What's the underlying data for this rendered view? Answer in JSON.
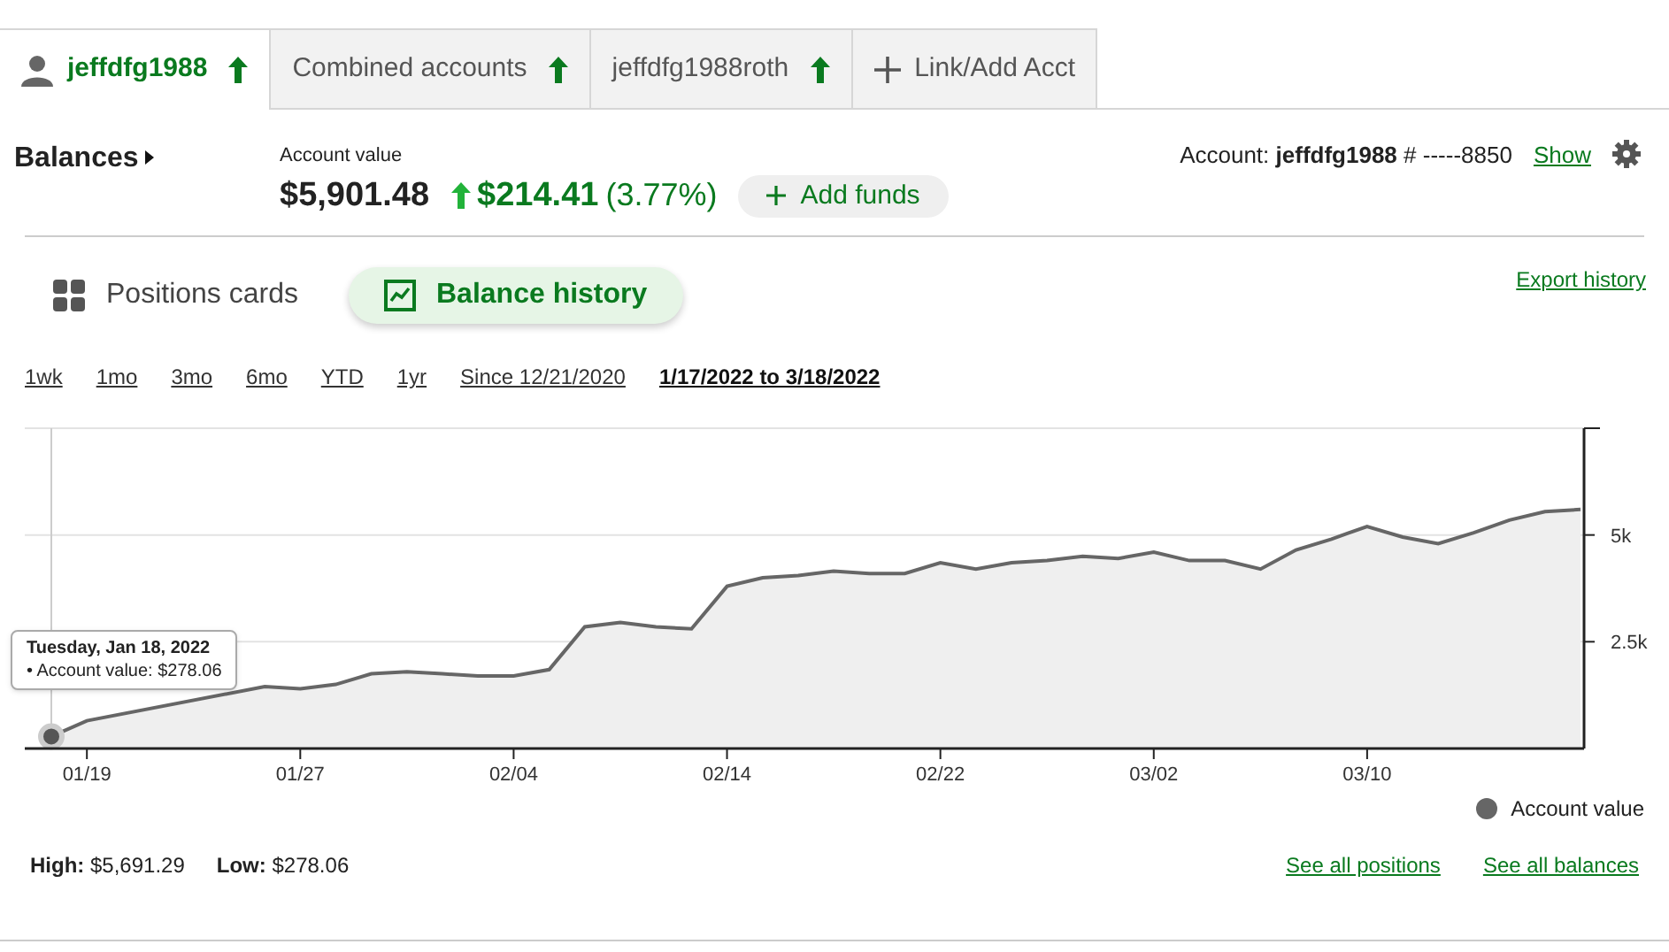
{
  "tabs": [
    {
      "label": "jeffdfg1988",
      "kind": "user",
      "selected": true
    },
    {
      "label": "Combined accounts",
      "kind": "account",
      "selected": false
    },
    {
      "label": "jeffdfg1988roth",
      "kind": "account",
      "selected": false
    },
    {
      "label": "Link/Add Acct",
      "kind": "add",
      "selected": false
    }
  ],
  "header": {
    "title": "Balances",
    "account_value_label": "Account value",
    "account_value": "$5,901.48",
    "change": "$214.41",
    "change_percent": "(3.77%)",
    "add_funds": "Add funds",
    "account_label": "Account:",
    "account_name": "jeffdfg1988",
    "account_number": "# -----8850",
    "show_link": "Show"
  },
  "views": [
    {
      "label": "Positions cards",
      "kind": "cards",
      "selected": false
    },
    {
      "label": "Balance history",
      "kind": "history",
      "selected": true
    }
  ],
  "export_link": "Export history",
  "periods": [
    {
      "label": "1wk",
      "selected": false
    },
    {
      "label": "1mo",
      "selected": false
    },
    {
      "label": "3mo",
      "selected": false
    },
    {
      "label": "6mo",
      "selected": false
    },
    {
      "label": "YTD",
      "selected": false
    },
    {
      "label": "1yr",
      "selected": false
    },
    {
      "label": "Since 12/21/2020",
      "selected": false
    },
    {
      "label": "1/17/2022 to 3/18/2022",
      "selected": true
    }
  ],
  "chart_data": {
    "type": "area",
    "categories": [
      null,
      "01/19",
      null,
      null,
      null,
      null,
      null,
      "01/27",
      null,
      null,
      null,
      null,
      null,
      "02/04",
      null,
      null,
      null,
      null,
      null,
      "02/14",
      null,
      null,
      null,
      null,
      null,
      "02/22",
      null,
      null,
      null,
      null,
      null,
      "03/02",
      null,
      null,
      null,
      null,
      null,
      "03/10",
      null,
      null,
      null,
      null,
      null,
      null
    ],
    "series": [
      {
        "name": "Account value",
        "color": "#666666",
        "values": [
          280,
          650,
          null,
          null,
          null,
          null,
          1450,
          1400,
          1500,
          1750,
          1800,
          1750,
          1700,
          1700,
          1850,
          2850,
          2950,
          2850,
          2800,
          3800,
          4000,
          4050,
          4150,
          4100,
          4100,
          4350,
          4200,
          4350,
          4400,
          4500,
          4450,
          4600,
          4400,
          4400,
          4200,
          4650,
          4900,
          5200,
          4950,
          4800,
          5050,
          5350,
          5550,
          5600
        ]
      }
    ],
    "ylim": [
      0,
      7500
    ],
    "yticks": [
      {
        "value": 2500,
        "label": "2.5k"
      },
      {
        "value": 5000,
        "label": "5k"
      }
    ]
  },
  "tooltip": {
    "title": "Tuesday, Jan 18, 2022",
    "text": "• Account value: $278.06"
  },
  "stats": {
    "high_label": "High:",
    "high": "$5,691.29",
    "low_label": "Low:",
    "low": "$278.06"
  },
  "links": [
    "See all positions",
    "See all balances"
  ]
}
